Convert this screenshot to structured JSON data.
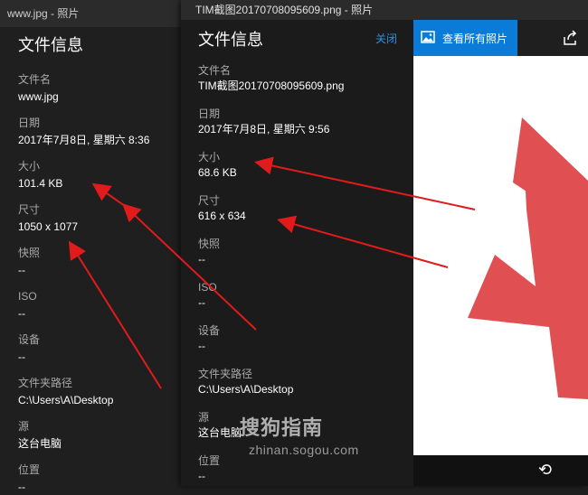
{
  "back_window": {
    "title": "www.jpg - 照片",
    "panel_title": "文件信息",
    "fields": [
      {
        "label": "文件名",
        "value": "www.jpg"
      },
      {
        "label": "日期",
        "value": "2017年7月8日, 星期六 8:36"
      },
      {
        "label": "大小",
        "value": "101.4 KB"
      },
      {
        "label": "尺寸",
        "value": "1050 x 1077"
      },
      {
        "label": "快照",
        "value": "--"
      },
      {
        "label": "ISO",
        "value": "--"
      },
      {
        "label": "设备",
        "value": "--"
      },
      {
        "label": "文件夹路径",
        "value": "C:\\Users\\A\\Desktop"
      },
      {
        "label": "源",
        "value": "这台电脑"
      },
      {
        "label": "位置",
        "value": "--"
      }
    ]
  },
  "front_window": {
    "title": "TIM截图20170708095609.png - 照片",
    "panel_title": "文件信息",
    "close_label": "关闭",
    "see_all_label": "查看所有照片",
    "fields": [
      {
        "label": "文件名",
        "value": "TIM截图20170708095609.png"
      },
      {
        "label": "日期",
        "value": "2017年7月8日, 星期六 9:56"
      },
      {
        "label": "大小",
        "value": "68.6 KB"
      },
      {
        "label": "尺寸",
        "value": "616 x 634"
      },
      {
        "label": "快照",
        "value": "--"
      },
      {
        "label": "ISO",
        "value": "--"
      },
      {
        "label": "设备",
        "value": "--"
      },
      {
        "label": "文件夹路径",
        "value": "C:\\Users\\A\\Desktop"
      },
      {
        "label": "源",
        "value": "这台电脑"
      },
      {
        "label": "位置",
        "value": "--"
      }
    ]
  },
  "watermark": {
    "main": "搜狗指南",
    "sub": "zhinan.sogou.com"
  },
  "colors": {
    "accent": "#0b7bd8",
    "link": "#2f8ee0",
    "arrow": "#e11b1b",
    "image_shape": "#e05052"
  },
  "icons": [
    "photo-icon",
    "share-icon",
    "back-arrow-icon"
  ]
}
